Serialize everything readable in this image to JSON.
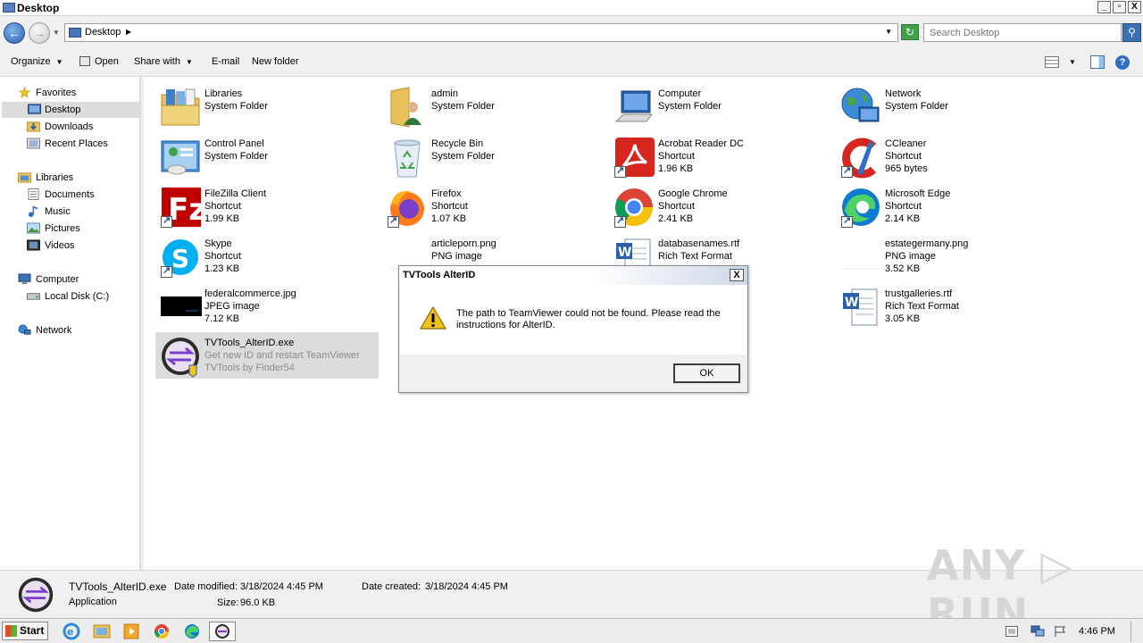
{
  "window": {
    "title": "Desktop",
    "minimize": "_",
    "restore": "▫",
    "close": "X"
  },
  "address": {
    "location": "Desktop",
    "search_placeholder": "Search Desktop"
  },
  "toolbar": {
    "organize": "Organize",
    "open": "Open",
    "share_with": "Share with",
    "email": "E-mail",
    "new_folder": "New folder"
  },
  "nav": {
    "favorites": "Favorites",
    "desktop": "Desktop",
    "downloads": "Downloads",
    "recent": "Recent Places",
    "libraries": "Libraries",
    "documents": "Documents",
    "music": "Music",
    "pictures": "Pictures",
    "videos": "Videos",
    "computer": "Computer",
    "localdisk": "Local Disk (C:)",
    "network": "Network"
  },
  "files": [
    {
      "name": "Libraries",
      "l1": "System Folder",
      "l2": ""
    },
    {
      "name": "admin",
      "l1": "System Folder",
      "l2": ""
    },
    {
      "name": "Computer",
      "l1": "System Folder",
      "l2": ""
    },
    {
      "name": "Network",
      "l1": "System Folder",
      "l2": ""
    },
    {
      "name": "Control Panel",
      "l1": "System Folder",
      "l2": ""
    },
    {
      "name": "Recycle Bin",
      "l1": "System Folder",
      "l2": ""
    },
    {
      "name": "Acrobat Reader DC",
      "l1": "Shortcut",
      "l2": "1.96 KB"
    },
    {
      "name": "CCleaner",
      "l1": "Shortcut",
      "l2": "965 bytes"
    },
    {
      "name": "FileZilla Client",
      "l1": "Shortcut",
      "l2": "1.99 KB"
    },
    {
      "name": "Firefox",
      "l1": "Shortcut",
      "l2": "1.07 KB"
    },
    {
      "name": "Google Chrome",
      "l1": "Shortcut",
      "l2": "2.41 KB"
    },
    {
      "name": "Microsoft Edge",
      "l1": "Shortcut",
      "l2": "2.14 KB"
    },
    {
      "name": "Skype",
      "l1": "Shortcut",
      "l2": "1.23 KB"
    },
    {
      "name": "articleporn.png",
      "l1": "PNG image",
      "l2": ""
    },
    {
      "name": "databasenames.rtf",
      "l1": "Rich Text Format",
      "l2": ""
    },
    {
      "name": "estategermany.png",
      "l1": "PNG image",
      "l2": "3.52 KB"
    },
    {
      "name": "federalcommerce.jpg",
      "l1": "JPEG image",
      "l2": "7.12 KB"
    },
    {
      "name": "trustgalleries.rtf",
      "l1": "Rich Text Format",
      "l2": "3.05 KB"
    },
    {
      "name": "TVTools_AlterID.exe",
      "l1": "Get new ID and restart TeamViewer",
      "l2": "TVTools by Finder54"
    }
  ],
  "details": {
    "name": "TVTools_AlterID.exe",
    "type": "Application",
    "modified_label": "Date modified:",
    "modified": "3/18/2024 4:45 PM",
    "created_label": "Date created:",
    "created": "3/18/2024 4:45 PM",
    "size_label": "Size:",
    "size": "96.0 KB"
  },
  "watermark": "ANY ▷ RUN",
  "dialog": {
    "title": "TVTools AlterID",
    "message": "The path to TeamViewer could not be found. Please read the instructions for AlterID.",
    "ok": "OK",
    "close": "X"
  },
  "taskbar": {
    "start": "Start",
    "time": "4:46 PM"
  }
}
